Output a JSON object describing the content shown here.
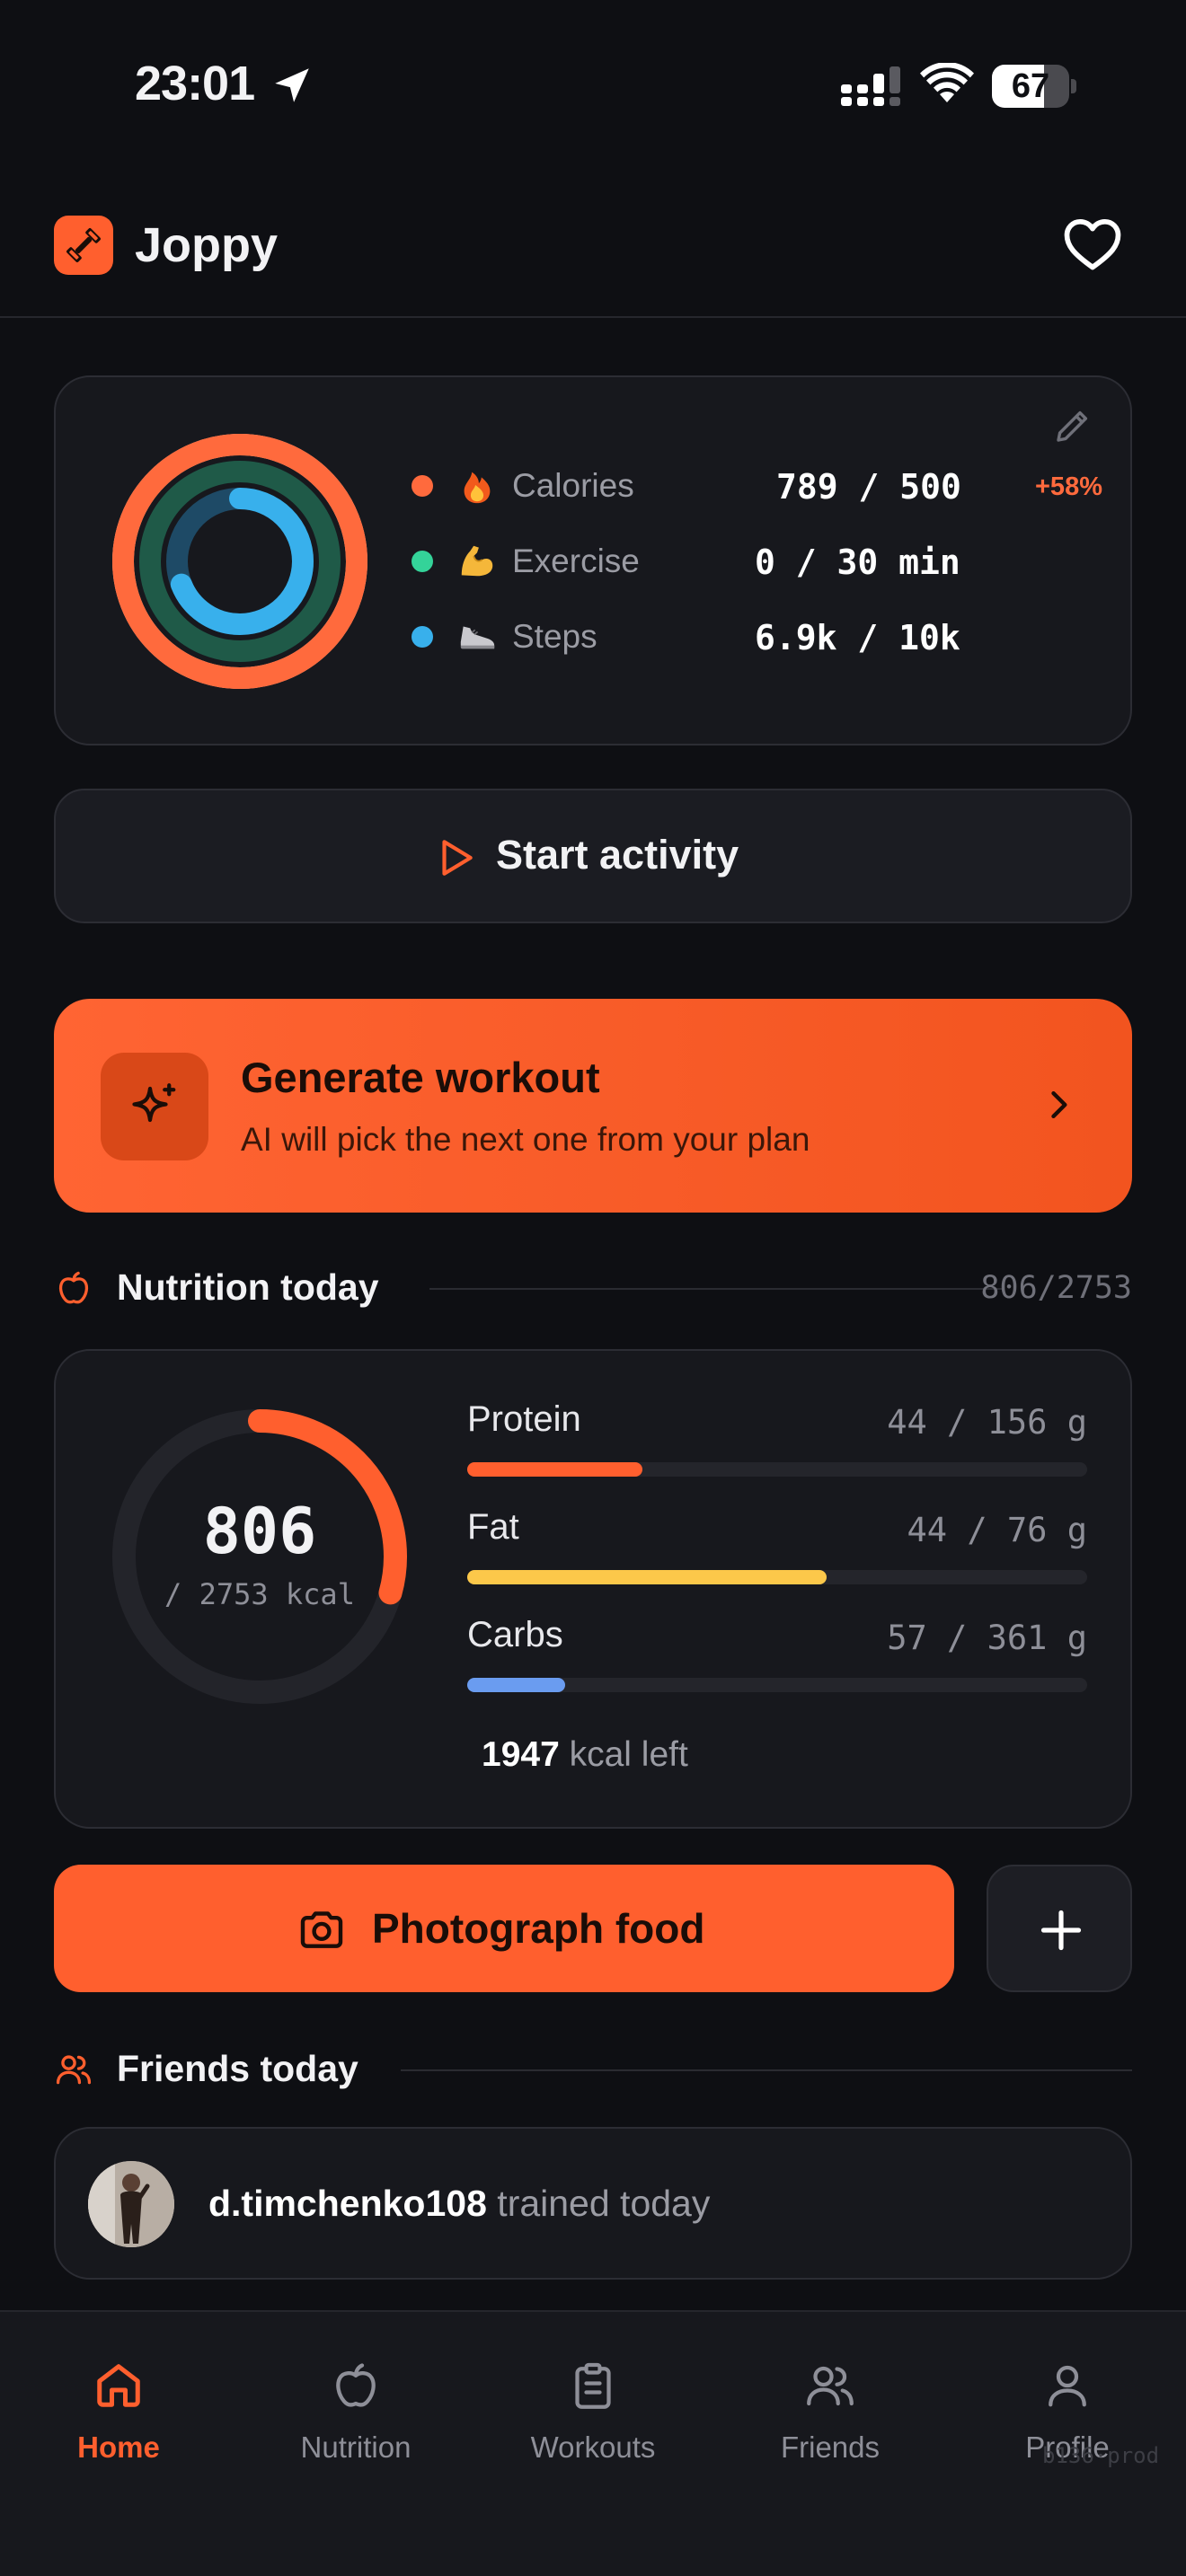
{
  "status_bar": {
    "time": "23:01",
    "battery": "67",
    "battery_level": 0.67,
    "icons": [
      "location-arrow-icon",
      "signal-icon",
      "wifi-icon",
      "battery-icon"
    ]
  },
  "header": {
    "app_name": "Joppy",
    "icons": [
      "app-logo-icon",
      "heart-icon"
    ]
  },
  "activity": {
    "stats": [
      {
        "label": "Calories",
        "emoji": "fire-icon",
        "value": "789 / 500",
        "badge": "+58%",
        "color": "#ff6a3d",
        "progress": 1.58
      },
      {
        "label": "Exercise",
        "emoji": "flexed-biceps-icon",
        "value": "0 / 30 min",
        "badge": "",
        "color": "#34d399",
        "progress": 0.0
      },
      {
        "label": "Steps",
        "emoji": "sneaker-icon",
        "value": "6.9k / 10k",
        "badge": "",
        "color": "#38b0ec",
        "progress": 0.69
      }
    ],
    "edit_icon": "pencil-icon"
  },
  "start_activity": {
    "label": "Start activity",
    "icon": "play-icon"
  },
  "generate_workout": {
    "title": "Generate workout",
    "subtitle": "AI will pick the next one from your plan",
    "icon": "sparkles-icon"
  },
  "nutrition": {
    "section_title": "Nutrition today",
    "section_count": "806/2753",
    "calories_value": "806",
    "calories_total": "/ 2753 kcal",
    "calories_progress": 0.293,
    "macros": [
      {
        "name": "Protein",
        "amount": "44 / 156 g",
        "progress": 0.282,
        "color": "#ff5f2e"
      },
      {
        "name": "Fat",
        "amount": "44 / 76 g",
        "progress": 0.579,
        "color": "#fcc84a"
      },
      {
        "name": "Carbs",
        "amount": "57 / 361 g",
        "progress": 0.158,
        "color": "#6a9cf0"
      }
    ],
    "kcal_left_value": "1947",
    "kcal_left_label": "kcal left"
  },
  "photo": {
    "label": "Photograph food",
    "icon": "camera-icon",
    "add_icon": "plus-icon"
  },
  "friends": {
    "section_title": "Friends today",
    "items": [
      {
        "name": "d.timchenko108",
        "activity": "trained today"
      }
    ]
  },
  "nav": {
    "items": [
      {
        "label": "Home",
        "icon": "home-icon",
        "active": true
      },
      {
        "label": "Nutrition",
        "icon": "apple-icon",
        "active": false
      },
      {
        "label": "Workouts",
        "icon": "clipboard-icon",
        "active": false
      },
      {
        "label": "Friends",
        "icon": "users-icon",
        "active": false
      },
      {
        "label": "Profile",
        "icon": "user-icon",
        "active": false
      }
    ],
    "build": "b136·prod"
  },
  "colors": {
    "accent": "#ff5f2e",
    "background": "#0e0f13",
    "card": "#17181d"
  }
}
